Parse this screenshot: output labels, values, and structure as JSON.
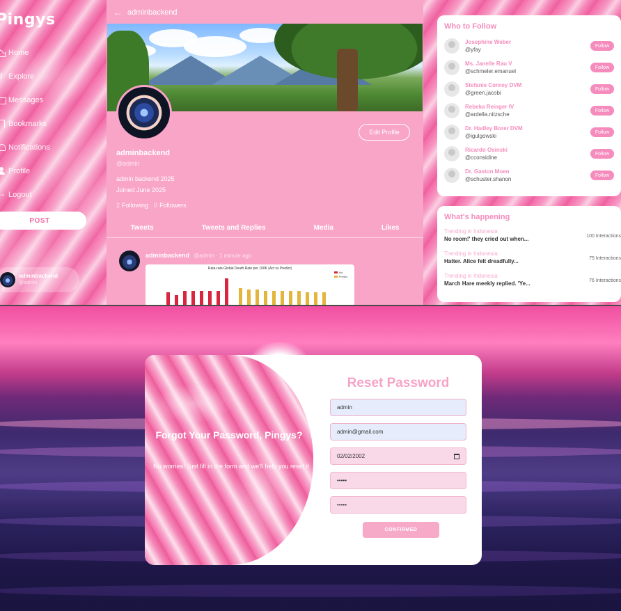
{
  "app": {
    "brand": "Pingys"
  },
  "sidebar": {
    "items": [
      {
        "label": "Home",
        "icon": "home-icon"
      },
      {
        "label": "Explore",
        "icon": "hashtag-icon"
      },
      {
        "label": "Messages",
        "icon": "mail-icon"
      },
      {
        "label": "Bookmarks",
        "icon": "bookmark-icon"
      },
      {
        "label": "Notifications",
        "icon": "bell-icon"
      },
      {
        "label": "Profile",
        "icon": "user-icon"
      },
      {
        "label": "Logout",
        "icon": "logout-icon"
      }
    ],
    "post_label": "POST",
    "user": {
      "name": "adminbackend",
      "handle": "@admin"
    }
  },
  "profile": {
    "topbar_title": "adminbackend",
    "edit_label": "Edit Profile",
    "name": "adminbackend",
    "handle": "@admin",
    "bio": "admin backend 2025",
    "joined": "Joined June 2025",
    "following_count": "2",
    "following_label": "Following",
    "followers_count": "0",
    "followers_label": "Followers",
    "tabs": [
      "Tweets",
      "Tweets and Replies",
      "Media",
      "Likes"
    ]
  },
  "tweet": {
    "author": "adminbackend",
    "meta": "@admin · 1 minute ago",
    "chart_title": "Rata-rata Global Death Rate per 100K (Act vs Predict)",
    "legend": [
      "Act",
      "Predict"
    ],
    "colors": {
      "act": "#d7263d",
      "predict": "#e3b53c"
    }
  },
  "who_to_follow": {
    "title": "Who to Follow",
    "follow_label": "Follow",
    "users": [
      {
        "name": "Josephine Weber",
        "handle": "@yfay"
      },
      {
        "name": "Ms. Janelle Rau V",
        "handle": "@schmeler.emanuel"
      },
      {
        "name": "Stefanie Conroy DVM",
        "handle": "@green.jacobi"
      },
      {
        "name": "Rebeka Reinger IV",
        "handle": "@ardella.nitzsche"
      },
      {
        "name": "Dr. Hadley Borer DVM",
        "handle": "@igulgowski"
      },
      {
        "name": "Ricardo Osinski",
        "handle": "@cconsidine"
      },
      {
        "name": "Dr. Gaston Moen",
        "handle": "@schuster.shanon"
      }
    ]
  },
  "whats_happening": {
    "title": "What's happening",
    "trends": [
      {
        "label": "Trending in Indonesia",
        "text": "No room!' they cried out when...",
        "count": "100 Interactions"
      },
      {
        "label": "Trending in Indonesia",
        "text": "Hatter. Alice felt dreadfully...",
        "count": "75 Interactions"
      },
      {
        "label": "Trending in Indonesia",
        "text": "March Hare meekly replied. 'Ye...",
        "count": "76 Interactions"
      }
    ]
  },
  "reset": {
    "art_title": "Forgot Your Password, Pingys?",
    "art_subtitle": "No worries! Just fill in the form and we'll help you reset it",
    "title": "Reset Password",
    "fields": {
      "username": "admin",
      "email": "admin@gmail.com",
      "date": "02/02/2002",
      "password": "•••••",
      "confirm_password": "•••••"
    },
    "confirm_label": "CONFIRMED"
  },
  "colors": {
    "brand_pink": "#f58cbd",
    "panel_pink": "#f9a5c8",
    "accent_text": "#f7a3c6"
  }
}
